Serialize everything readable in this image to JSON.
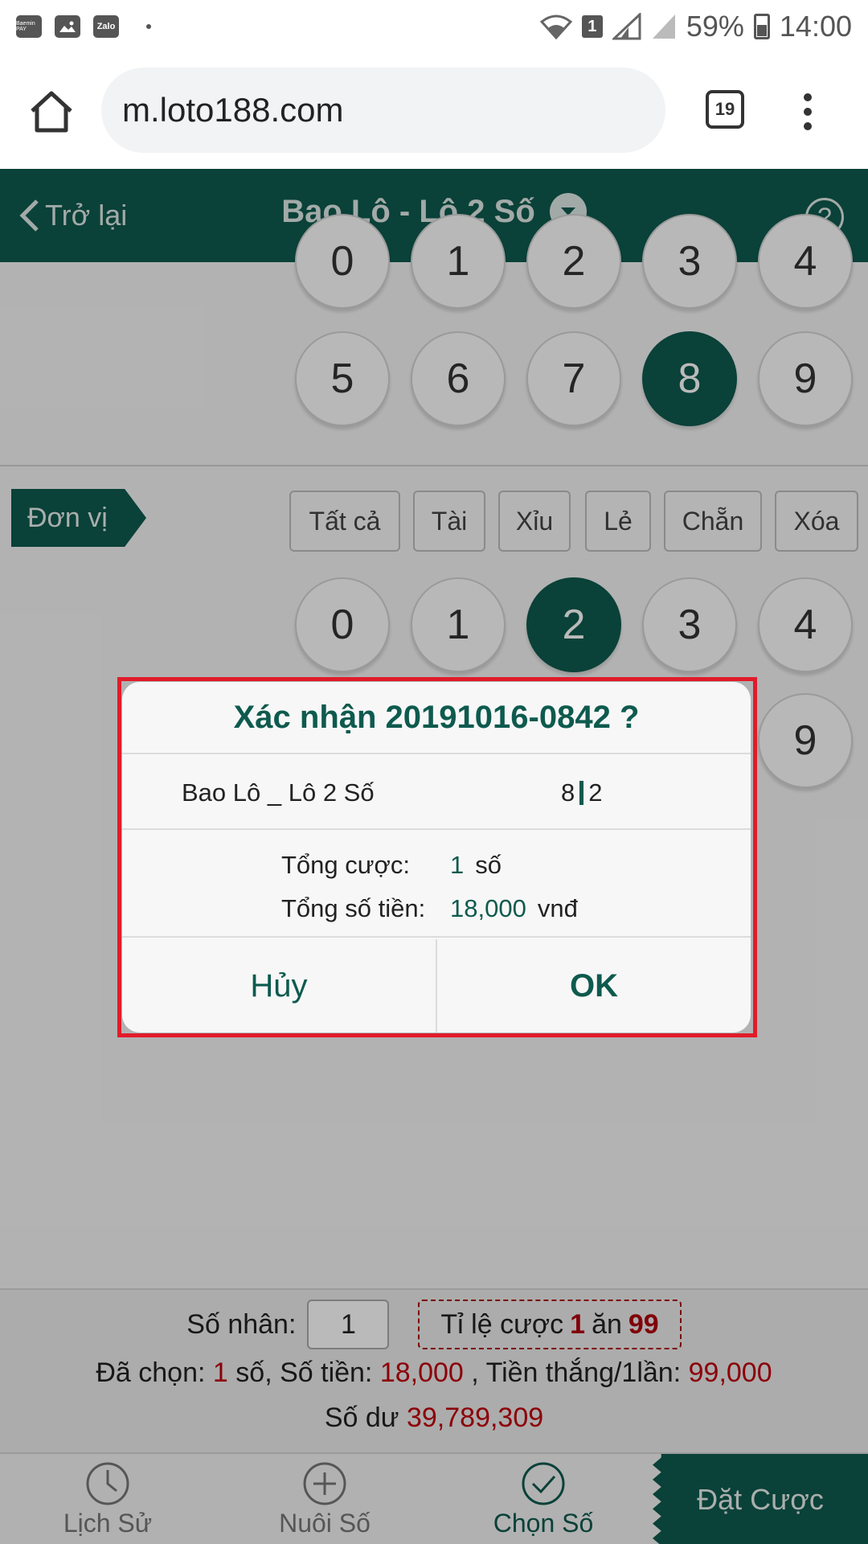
{
  "status_bar": {
    "app_icons": [
      "Baemin PAY",
      "gallery",
      "Zalo"
    ],
    "sim_label": "1",
    "battery": "59%",
    "time": "14:00"
  },
  "browser": {
    "url": "m.loto188.com",
    "tab_count": "19"
  },
  "header": {
    "back_label": "Trở lại",
    "title": "Bao Lô - Lô 2 Số",
    "help_label": "?"
  },
  "top_row": {
    "partial_digits": [
      "0",
      "1",
      "2",
      "3",
      "4"
    ],
    "digits": [
      "5",
      "6",
      "7",
      "8",
      "9"
    ],
    "selected": "8"
  },
  "unit_section": {
    "label": "Đơn vị",
    "filters": [
      "Tất cả",
      "Tài",
      "Xỉu",
      "Lẻ",
      "Chẵn",
      "Xóa"
    ],
    "digits_row1": [
      "0",
      "1",
      "2",
      "3",
      "4"
    ],
    "selected": "2",
    "visible_digit_row2": "9"
  },
  "info": {
    "multiplier_label": "Số nhân:",
    "multiplier_value": "1",
    "ratio_prefix": "Tỉ lệ cược",
    "ratio_a": "1",
    "ratio_mid": "ăn",
    "ratio_b": "99",
    "chosen_label": "Đã chọn:",
    "chosen_count": "1",
    "chosen_unit": "số, Số tiền:",
    "amount": "18,000",
    "win_label": ", Tiền thắng/1lần:",
    "win_amount": "99,000",
    "balance_label": "Số dư",
    "balance": "39,789,309"
  },
  "bottom_nav": {
    "history": "Lịch Sử",
    "nurture": "Nuôi Số",
    "choose": "Chọn Số",
    "bet": "Đặt Cược"
  },
  "dialog": {
    "title": "Xác nhận 20191016-0842 ?",
    "game": "Bao Lô _ Lô 2 Số",
    "num_a": "8",
    "num_b": "2",
    "total_bet_label": "Tổng cược:",
    "total_bet_value": "1",
    "total_bet_unit": "số",
    "total_money_label": "Tổng số tiền:",
    "total_money_value": "18,000",
    "total_money_unit": "vnđ",
    "cancel_label": "Hủy",
    "ok_label": "OK"
  },
  "colors": {
    "brand": "#0e5a4e",
    "accent_red": "#c0000c",
    "highlight_border": "#e11b2a"
  }
}
